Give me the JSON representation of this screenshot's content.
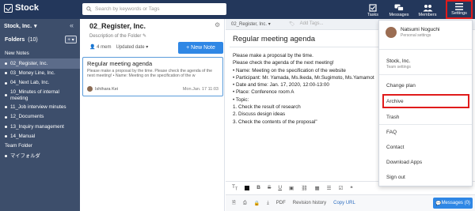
{
  "app": {
    "name": "Stock"
  },
  "search": {
    "placeholder": "Search by keywords or Tags"
  },
  "topnav": [
    {
      "label": "Tasks",
      "icon": "checkbox-icon"
    },
    {
      "label": "Messages",
      "icon": "chat-bubbles-icon"
    },
    {
      "label": "Members",
      "icon": "people-icon"
    },
    {
      "label": "Settings",
      "icon": "hamburger-menu-icon"
    }
  ],
  "sidebar": {
    "workspace": "Stock, Inc.",
    "folders_label": "Folders",
    "folders_count": "(10)",
    "plus_label": "+ ▾",
    "items": [
      {
        "label": "New Notes",
        "type": "header"
      },
      {
        "label": "02_Register, Inc.",
        "type": "folder"
      },
      {
        "label": "03_Money Line, Inc.",
        "type": "folder"
      },
      {
        "label": "04_Next Lab, Inc.",
        "type": "folder"
      },
      {
        "label": "10_Minutes of internal meeting",
        "type": "folder"
      },
      {
        "label": "11_Job interview minutes",
        "type": "folder"
      },
      {
        "label": "12_Documents",
        "type": "folder"
      },
      {
        "label": "13_Inquiry management",
        "type": "folder"
      },
      {
        "label": "14_Manual",
        "type": "folder"
      },
      {
        "label": "Team Folder",
        "type": "plain"
      },
      {
        "label": "マイフォルダ",
        "type": "folder"
      }
    ]
  },
  "middle": {
    "folder_title": "02_Register, Inc.",
    "description": "Description of the Folder",
    "members": "4 mem",
    "sort": "Updated date",
    "new_note_label": "+ New Note",
    "note": {
      "title": "Regular meeting agenda",
      "snippet": "Please make a proposal by the time. Please check the agenda of the next meeting! • Name: Meeting on the specification of the w",
      "author": "Ishihara Kei",
      "date": "Mon.Jan. 17 11:03"
    }
  },
  "editor": {
    "folder": "02_Register, Inc. ▾",
    "tags_placeholder": "Add Tags...",
    "title": "Regular meeting agenda",
    "body": [
      "Please make a proposal by the time.",
      "Please check the agenda of the next meeting!",
      "• Name: Meeting on the specification of the website",
      "• Participant: Mr. Yamada, Ms.Ikeda, Mr.Sugimoto, Ms.Yamamot",
      "• Date and time: Jan. 17, 2020, 12:00-13:00",
      "• Place: Conference room A",
      "• Topic:",
      "1. Check the result of research",
      "2. Discuss design ideas",
      "3. Check the contents of the proposal\""
    ],
    "bottom": {
      "pdf": "PDF",
      "revision": "Revision history",
      "copy_url": "Copy URL",
      "messages_btn": "Messages (0)"
    }
  },
  "dropdown": {
    "user_name": "Natsumi   Noguchi",
    "user_sub": "Personal settings",
    "team_name": "Stock, Inc.",
    "team_sub": "Team settings",
    "items": [
      "Change plan",
      "Archive",
      "Trash",
      "FAQ",
      "Contact",
      "Download Apps",
      "Sign out"
    ]
  },
  "colors": {
    "topbar": "#23375b",
    "sidebar": "#3d4e6b",
    "accent": "#2f87e5",
    "highlight": "#e01b1b"
  }
}
